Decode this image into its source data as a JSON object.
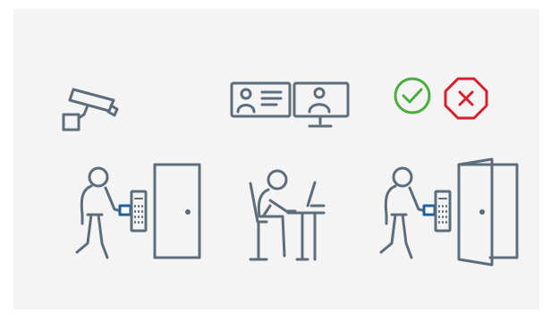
{
  "colors": {
    "background": "#f4f4f5",
    "outline": "#5d6d7b",
    "card_accent": "#1f5fa3",
    "approve": "#4aad3e",
    "deny": "#d81f2b"
  },
  "icons": {
    "camera": "security-camera-icon",
    "id_card": "id-card-icon",
    "monitor": "monitor-user-icon",
    "approve": "check-circle-icon",
    "deny": "x-octagon-icon",
    "door_closed": "closed-door-icon",
    "door_open": "open-door-icon",
    "keypad": "keypad-reader-icon",
    "operator": "operator-at-desk-icon",
    "person": "person-with-card-icon"
  },
  "scenes": [
    {
      "key": "badge-in",
      "state": "door-closed"
    },
    {
      "key": "verification",
      "state": "monitoring"
    },
    {
      "key": "access-granted",
      "state": "door-open"
    }
  ]
}
